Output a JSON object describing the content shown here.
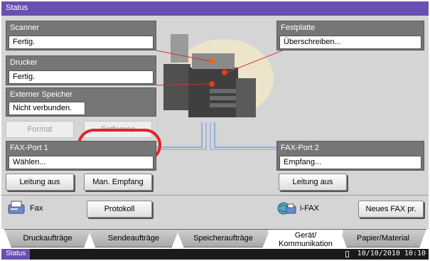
{
  "title": "Status",
  "panels": {
    "scanner": {
      "label": "Scanner",
      "value": "Fertig."
    },
    "printer": {
      "label": "Drucker",
      "value": "Fertig."
    },
    "ext_storage": {
      "label": "Externer Speicher",
      "value": "Nicht verbunden."
    },
    "hdd": {
      "label": "Festplatte",
      "value": "Überschreiben..."
    },
    "fax1": {
      "label": "FAX-Port 1",
      "value": "Wählen..."
    },
    "fax2": {
      "label": "FAX-Port 2",
      "value": "Empfang..."
    }
  },
  "buttons": {
    "format": "Format",
    "remove": "Entfernen",
    "line_off_1": "Leitung aus",
    "manual_receive": "Man. Empfang",
    "line_off_2": "Leitung aus",
    "log": "Protokoll",
    "new_ifax": "Neues FAX pr."
  },
  "icons": {
    "fax_label": "Fax",
    "ifax_label": "i-FAX"
  },
  "tabs": [
    {
      "label": "Druckaufträge"
    },
    {
      "label": "Sendeaufträge"
    },
    {
      "label": "Speicheraufträge"
    },
    {
      "label": "Gerät/\nKommunikation",
      "active": true
    },
    {
      "label": "Papier/Material"
    }
  ],
  "statusbar": {
    "label": "Status",
    "datetime": "10/10/2010  10:10"
  },
  "colors": {
    "accent": "#6a4fb2",
    "highlight": "#e0242b",
    "panel": "#767676"
  }
}
